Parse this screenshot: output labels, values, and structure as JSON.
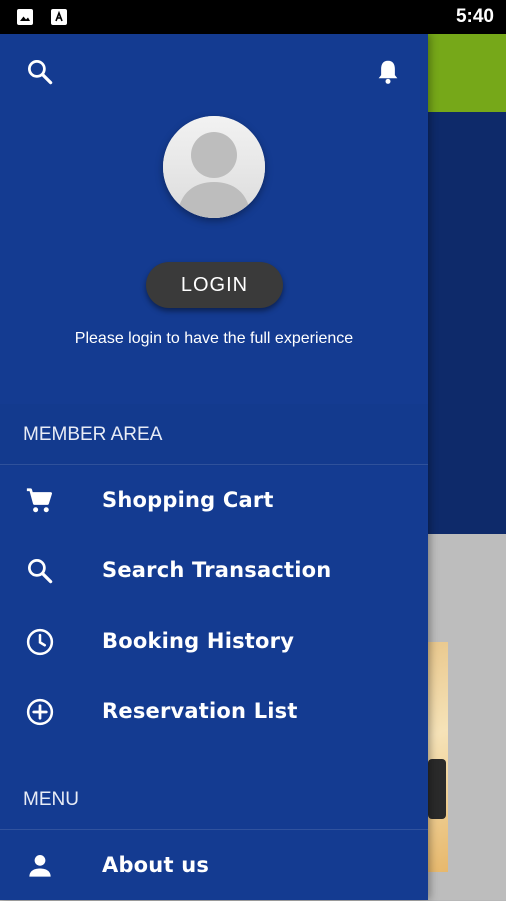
{
  "status_bar": {
    "time": "5:40",
    "icons": [
      "gallery-icon",
      "text-a-icon"
    ]
  },
  "drawer": {
    "top_icons": [
      "search-icon",
      "bell-icon"
    ],
    "avatar_icon": "avatar-placeholder-icon",
    "login_label": "LOGIN",
    "login_hint": "Please login to have the full experience",
    "member_area": {
      "title": "MEMBER AREA",
      "items": [
        {
          "label": "Shopping Cart",
          "icon": "cart-icon"
        },
        {
          "label": "Search Transaction",
          "icon": "search-icon"
        },
        {
          "label": "Booking History",
          "icon": "clock-icon"
        },
        {
          "label": "Reservation List",
          "icon": "add-circle-icon"
        }
      ]
    },
    "menu": {
      "title": "MENU",
      "items": [
        {
          "label": "About us",
          "icon": "person-icon"
        }
      ]
    }
  },
  "colors": {
    "drawer_bg": "#143b91",
    "login_button_bg": "#3a3a3a",
    "status_bar_bg": "#000000",
    "background_green": "#76a819",
    "background_navy": "#0e2a6a"
  }
}
